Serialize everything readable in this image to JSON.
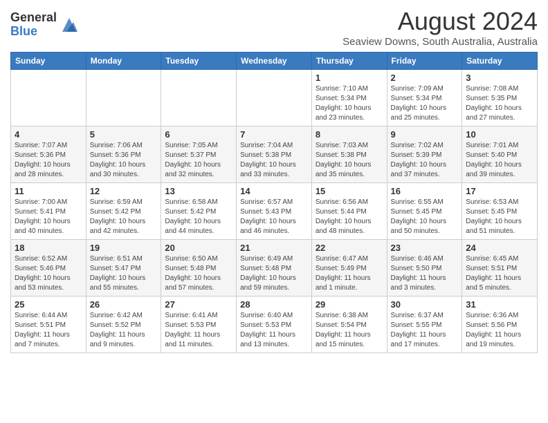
{
  "logo": {
    "general": "General",
    "blue": "Blue"
  },
  "title": {
    "month": "August 2024",
    "location": "Seaview Downs, South Australia, Australia"
  },
  "headers": [
    "Sunday",
    "Monday",
    "Tuesday",
    "Wednesday",
    "Thursday",
    "Friday",
    "Saturday"
  ],
  "weeks": [
    [
      {
        "day": "",
        "info": ""
      },
      {
        "day": "",
        "info": ""
      },
      {
        "day": "",
        "info": ""
      },
      {
        "day": "",
        "info": ""
      },
      {
        "day": "1",
        "info": "Sunrise: 7:10 AM\nSunset: 5:34 PM\nDaylight: 10 hours\nand 23 minutes."
      },
      {
        "day": "2",
        "info": "Sunrise: 7:09 AM\nSunset: 5:34 PM\nDaylight: 10 hours\nand 25 minutes."
      },
      {
        "day": "3",
        "info": "Sunrise: 7:08 AM\nSunset: 5:35 PM\nDaylight: 10 hours\nand 27 minutes."
      }
    ],
    [
      {
        "day": "4",
        "info": "Sunrise: 7:07 AM\nSunset: 5:36 PM\nDaylight: 10 hours\nand 28 minutes."
      },
      {
        "day": "5",
        "info": "Sunrise: 7:06 AM\nSunset: 5:36 PM\nDaylight: 10 hours\nand 30 minutes."
      },
      {
        "day": "6",
        "info": "Sunrise: 7:05 AM\nSunset: 5:37 PM\nDaylight: 10 hours\nand 32 minutes."
      },
      {
        "day": "7",
        "info": "Sunrise: 7:04 AM\nSunset: 5:38 PM\nDaylight: 10 hours\nand 33 minutes."
      },
      {
        "day": "8",
        "info": "Sunrise: 7:03 AM\nSunset: 5:38 PM\nDaylight: 10 hours\nand 35 minutes."
      },
      {
        "day": "9",
        "info": "Sunrise: 7:02 AM\nSunset: 5:39 PM\nDaylight: 10 hours\nand 37 minutes."
      },
      {
        "day": "10",
        "info": "Sunrise: 7:01 AM\nSunset: 5:40 PM\nDaylight: 10 hours\nand 39 minutes."
      }
    ],
    [
      {
        "day": "11",
        "info": "Sunrise: 7:00 AM\nSunset: 5:41 PM\nDaylight: 10 hours\nand 40 minutes."
      },
      {
        "day": "12",
        "info": "Sunrise: 6:59 AM\nSunset: 5:42 PM\nDaylight: 10 hours\nand 42 minutes."
      },
      {
        "day": "13",
        "info": "Sunrise: 6:58 AM\nSunset: 5:42 PM\nDaylight: 10 hours\nand 44 minutes."
      },
      {
        "day": "14",
        "info": "Sunrise: 6:57 AM\nSunset: 5:43 PM\nDaylight: 10 hours\nand 46 minutes."
      },
      {
        "day": "15",
        "info": "Sunrise: 6:56 AM\nSunset: 5:44 PM\nDaylight: 10 hours\nand 48 minutes."
      },
      {
        "day": "16",
        "info": "Sunrise: 6:55 AM\nSunset: 5:45 PM\nDaylight: 10 hours\nand 50 minutes."
      },
      {
        "day": "17",
        "info": "Sunrise: 6:53 AM\nSunset: 5:45 PM\nDaylight: 10 hours\nand 51 minutes."
      }
    ],
    [
      {
        "day": "18",
        "info": "Sunrise: 6:52 AM\nSunset: 5:46 PM\nDaylight: 10 hours\nand 53 minutes."
      },
      {
        "day": "19",
        "info": "Sunrise: 6:51 AM\nSunset: 5:47 PM\nDaylight: 10 hours\nand 55 minutes."
      },
      {
        "day": "20",
        "info": "Sunrise: 6:50 AM\nSunset: 5:48 PM\nDaylight: 10 hours\nand 57 minutes."
      },
      {
        "day": "21",
        "info": "Sunrise: 6:49 AM\nSunset: 5:48 PM\nDaylight: 10 hours\nand 59 minutes."
      },
      {
        "day": "22",
        "info": "Sunrise: 6:47 AM\nSunset: 5:49 PM\nDaylight: 11 hours\nand 1 minute."
      },
      {
        "day": "23",
        "info": "Sunrise: 6:46 AM\nSunset: 5:50 PM\nDaylight: 11 hours\nand 3 minutes."
      },
      {
        "day": "24",
        "info": "Sunrise: 6:45 AM\nSunset: 5:51 PM\nDaylight: 11 hours\nand 5 minutes."
      }
    ],
    [
      {
        "day": "25",
        "info": "Sunrise: 6:44 AM\nSunset: 5:51 PM\nDaylight: 11 hours\nand 7 minutes."
      },
      {
        "day": "26",
        "info": "Sunrise: 6:42 AM\nSunset: 5:52 PM\nDaylight: 11 hours\nand 9 minutes."
      },
      {
        "day": "27",
        "info": "Sunrise: 6:41 AM\nSunset: 5:53 PM\nDaylight: 11 hours\nand 11 minutes."
      },
      {
        "day": "28",
        "info": "Sunrise: 6:40 AM\nSunset: 5:53 PM\nDaylight: 11 hours\nand 13 minutes."
      },
      {
        "day": "29",
        "info": "Sunrise: 6:38 AM\nSunset: 5:54 PM\nDaylight: 11 hours\nand 15 minutes."
      },
      {
        "day": "30",
        "info": "Sunrise: 6:37 AM\nSunset: 5:55 PM\nDaylight: 11 hours\nand 17 minutes."
      },
      {
        "day": "31",
        "info": "Sunrise: 6:36 AM\nSunset: 5:56 PM\nDaylight: 11 hours\nand 19 minutes."
      }
    ]
  ]
}
